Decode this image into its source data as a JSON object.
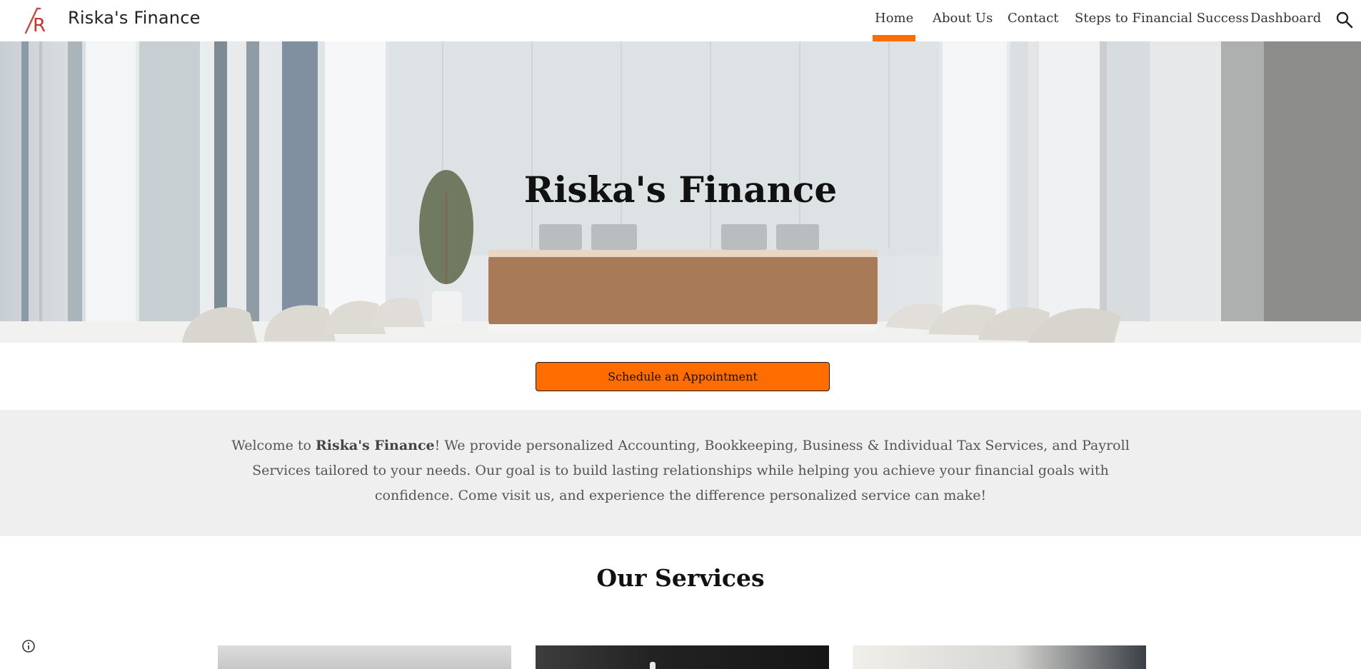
{
  "header": {
    "site_title": "Riska's Finance",
    "logo_text": "R",
    "nav": [
      {
        "label": "Home",
        "active": true
      },
      {
        "label": "About Us",
        "active": false
      },
      {
        "label": "Contact",
        "active": false
      },
      {
        "label": "Steps to Financial Success",
        "active": false
      },
      {
        "label": "Dashboard",
        "active": false
      }
    ],
    "search_icon": "search-icon"
  },
  "hero": {
    "title": "Riska's Finance"
  },
  "cta": {
    "label": "Schedule an Appointment"
  },
  "welcome": {
    "prefix": "Welcome to ",
    "brand": "Riska's Finance",
    "body": "! We provide personalized Accounting, Bookkeeping, Business & Individual Tax Services, and Payroll Services tailored to your needs. Our goal is to build lasting relationships while helping you achieve your financial goals with confidence. Come visit us, and experience the difference personalized service can make!"
  },
  "services": {
    "title": "Our Services"
  },
  "colors": {
    "accent": "#ff6d00",
    "band": "#efefef",
    "text": "#222222"
  },
  "footer": {
    "info_icon": "info-icon"
  }
}
